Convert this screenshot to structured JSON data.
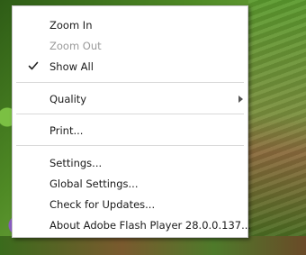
{
  "menu": {
    "items": [
      {
        "label": "Zoom In",
        "enabled": true,
        "checked": false,
        "submenu": false
      },
      {
        "label": "Zoom Out",
        "enabled": false,
        "checked": false,
        "submenu": false
      },
      {
        "label": "Show All",
        "enabled": true,
        "checked": true,
        "submenu": false
      },
      {
        "label": "Quality",
        "enabled": true,
        "checked": false,
        "submenu": true
      },
      {
        "label": "Print...",
        "enabled": true,
        "checked": false,
        "submenu": false
      },
      {
        "label": "Settings...",
        "enabled": true,
        "checked": false,
        "submenu": false
      },
      {
        "label": "Global Settings...",
        "enabled": true,
        "checked": false,
        "submenu": false
      },
      {
        "label": "Check for Updates...",
        "enabled": true,
        "checked": false,
        "submenu": false
      },
      {
        "label": "About Adobe Flash Player 28.0.0.137...",
        "enabled": true,
        "checked": false,
        "submenu": false
      }
    ]
  },
  "colors": {
    "menu_bg": "#ffffff",
    "text": "#1a1a1a",
    "disabled_text": "#9a9a9a",
    "separator": "#d9d9d9"
  },
  "icons": {
    "check": "checkmark-icon",
    "submenu": "submenu-arrow-icon"
  }
}
